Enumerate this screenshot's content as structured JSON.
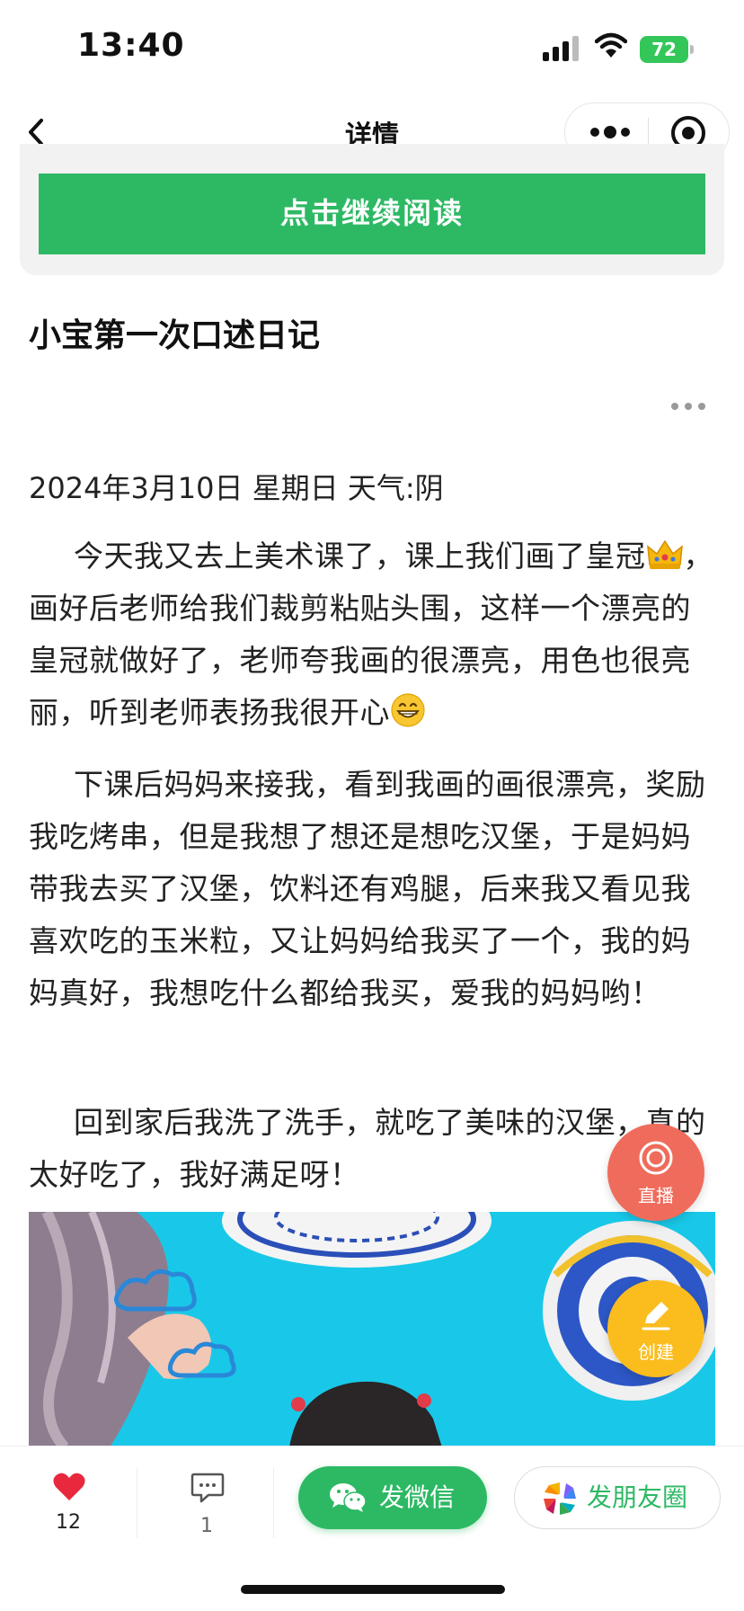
{
  "status_bar": {
    "time": "13:40",
    "battery": "72"
  },
  "nav": {
    "title": "详情"
  },
  "continue_button": "点击继续阅读",
  "article": {
    "title": "小宝第一次口述日记",
    "date_line": "2024年3月10日 星期日 天气:阴",
    "p1_a": "今天我又去上美术课了，课上我们画了皇冠",
    "p1_b": "，画好后老师给我们裁剪粘贴头围，这样一个漂亮的皇冠就做好了，老师夸我画的很漂亮，用色也很亮丽，听到老师表扬我很开心",
    "p2": "下课后妈妈来接我，看到我画的画很漂亮，奖励我吃烤串，但是我想了想还是想吃汉堡，于是妈妈带我去买了汉堡，饮料还有鸡腿，后来我又看见我喜欢吃的玉米粒，又让妈妈给我买了一个，我的妈妈真好，我想吃什么都给我买，爱我的妈妈哟！",
    "p3": "回到家后我洗了洗手，就吃了美味的汉堡，真的太好吃了，我好满足呀！"
  },
  "fab": {
    "live_label": "直播",
    "create_label": "创建"
  },
  "bottom_bar": {
    "like_count": "12",
    "comment_count": "1",
    "wechat_label": "发微信",
    "moments_label": "发朋友圈"
  },
  "colors": {
    "accent_green": "#2db964",
    "like_red": "#e8283c",
    "live_red": "#ef6c5c",
    "create_yellow": "#fbbd1e"
  }
}
